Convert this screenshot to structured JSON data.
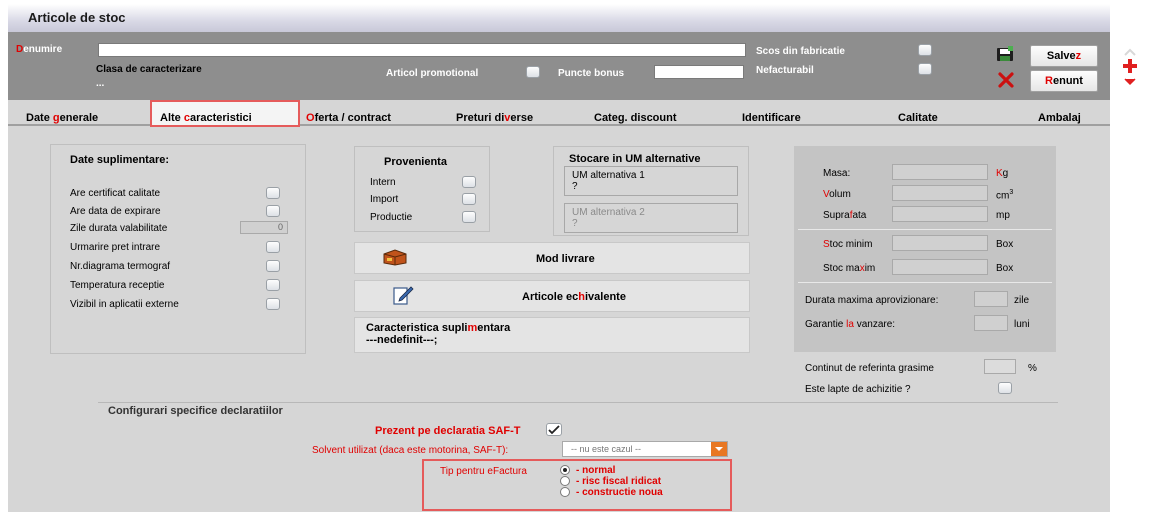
{
  "window": {
    "title": "Articole de stoc"
  },
  "header": {
    "denumire_hotkey": "D",
    "denumire_rest": "enumire",
    "denumire_value": "",
    "clasa_hotkey": "Cl",
    "clasa_rest": "asa de caracterizare",
    "clasa_value": "...",
    "articol_promotional": "Articol promotional",
    "puncte_bonus": "Puncte bonus",
    "puncte_bonus_value": "",
    "scos_din_fabricatie": "Scos din fabricatie",
    "nefacturabil": "Nefacturabil",
    "save_pre": "Salve",
    "save_hotkey": "z",
    "cancel_hotkey": "R",
    "cancel_rest": "enunt"
  },
  "tabs": [
    {
      "pre": "Date ",
      "hk": "g",
      "post": "enerale"
    },
    {
      "pre": "Alte ",
      "hk": "c",
      "post": "aracteristici"
    },
    {
      "pre": "",
      "hk": "O",
      "post": "ferta / contract"
    },
    {
      "pre": "Preturi di",
      "hk": "v",
      "post": "erse"
    },
    {
      "pre": "Categ. discount",
      "hk": "",
      "post": ""
    },
    {
      "pre": "Identificare",
      "hk": "",
      "post": ""
    },
    {
      "pre": "Calitate",
      "hk": "",
      "post": ""
    },
    {
      "pre": "Ambalaj",
      "hk": "",
      "post": ""
    }
  ],
  "date_suplimentare": {
    "title": "Date suplimentare:",
    "rows": [
      "Are certificat calitate",
      "Are data de expirare",
      "Zile durata valabilitate",
      "Urmarire pret intrare",
      "Nr.diagrama termograf",
      "Temperatura receptie",
      "Vizibil in aplicatii externe"
    ],
    "zile_value": "0"
  },
  "provenienta": {
    "title": "Provenienta",
    "options": [
      "Intern",
      "Import",
      "Productie"
    ]
  },
  "stocare_um": {
    "title": "Stocare in UM alternative",
    "um1_label": "UM alternativa 1",
    "um1_value": "?",
    "um2_label": "UM alternativa 2",
    "um2_value": "?"
  },
  "actions": {
    "mod_livrare": "Mod livrare",
    "articole_pre": "Articole ec",
    "articole_hk": "h",
    "articole_post": "ivalente"
  },
  "caracteristica": {
    "pre": "Caracteristica supli",
    "hk": "m",
    "post": "entara",
    "value": "---nedefinit---;"
  },
  "dimensiuni": {
    "masa_label": "Masa:",
    "masa_unit_hk": "K",
    "masa_unit_rest": "g",
    "volum_hk": "V",
    "volum_rest": "olum",
    "volum_unit": "cm",
    "volum_sup": "3",
    "suprafata_pre": "Supra",
    "suprafata_hk": "f",
    "suprafata_post": "ata",
    "suprafata_unit": "mp",
    "stoc_minim_hk": "S",
    "stoc_minim_rest": "toc minim",
    "stoc_minim_unit": "Box",
    "stoc_maxim_pre": "Stoc ma",
    "stoc_maxim_hk": "x",
    "stoc_maxim_post": "im",
    "stoc_maxim_unit": "Box",
    "durata_label": "Durata maxima aprovizionare:",
    "durata_unit": "zile",
    "garantie_pre": "Garantie ",
    "garantie_hk": "la",
    "garantie_post": " vanzare:",
    "garantie_unit": "luni"
  },
  "extra": {
    "continut_label": "Continut de referinta grasime",
    "continut_unit": "%",
    "lapte_label": "Este lapte de achizitie ?"
  },
  "declaratii": {
    "title": "Configurari specifice declaratiilor",
    "saft_label": "Prezent pe declaratia SAF-T",
    "solvent_label": "Solvent utilizat (daca este motorina, SAF-T):",
    "solvent_value": "-- nu este cazul --",
    "efactura_label": "Tip pentru eFactura",
    "efactura_options": [
      "- normal",
      "- risc fiscal ridicat",
      "- constructie noua"
    ]
  },
  "colors": {
    "accent_red": "#e00000",
    "header_gray": "#8e8e8e",
    "highlight": "#e55b5b"
  }
}
